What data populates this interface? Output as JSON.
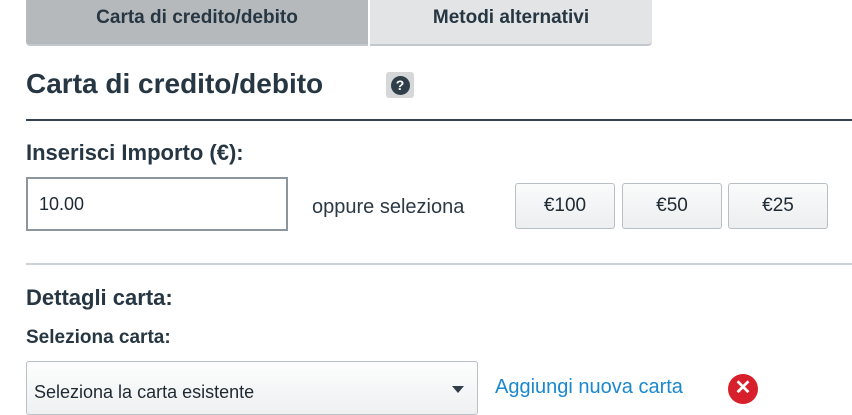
{
  "tabs": [
    {
      "label": "Carta di credito/debito"
    },
    {
      "label": "Metodi alternativi"
    }
  ],
  "section": {
    "title": "Carta di credito/debito",
    "help_icon_glyph": "?"
  },
  "amount": {
    "label": "Inserisci Importo (€):",
    "value": "10.00",
    "or_text": "oppure seleziona",
    "presets": [
      "€100",
      "€50",
      "€25"
    ]
  },
  "card": {
    "details_label": "Dettagli carta:",
    "select_label": "Seleziona carta:",
    "select_value": "Seleziona la carta esistente",
    "add_new_label": "Aggiungi nuova carta",
    "remove_icon_glyph": "✕"
  },
  "colors": {
    "link": "#1a88cf",
    "danger": "#d7202b",
    "active_tab": "#b6b9bc",
    "inactive_tab": "#e3e4e5"
  },
  "icons": [
    "help-icon",
    "dropdown-arrow-icon",
    "close-icon"
  ]
}
